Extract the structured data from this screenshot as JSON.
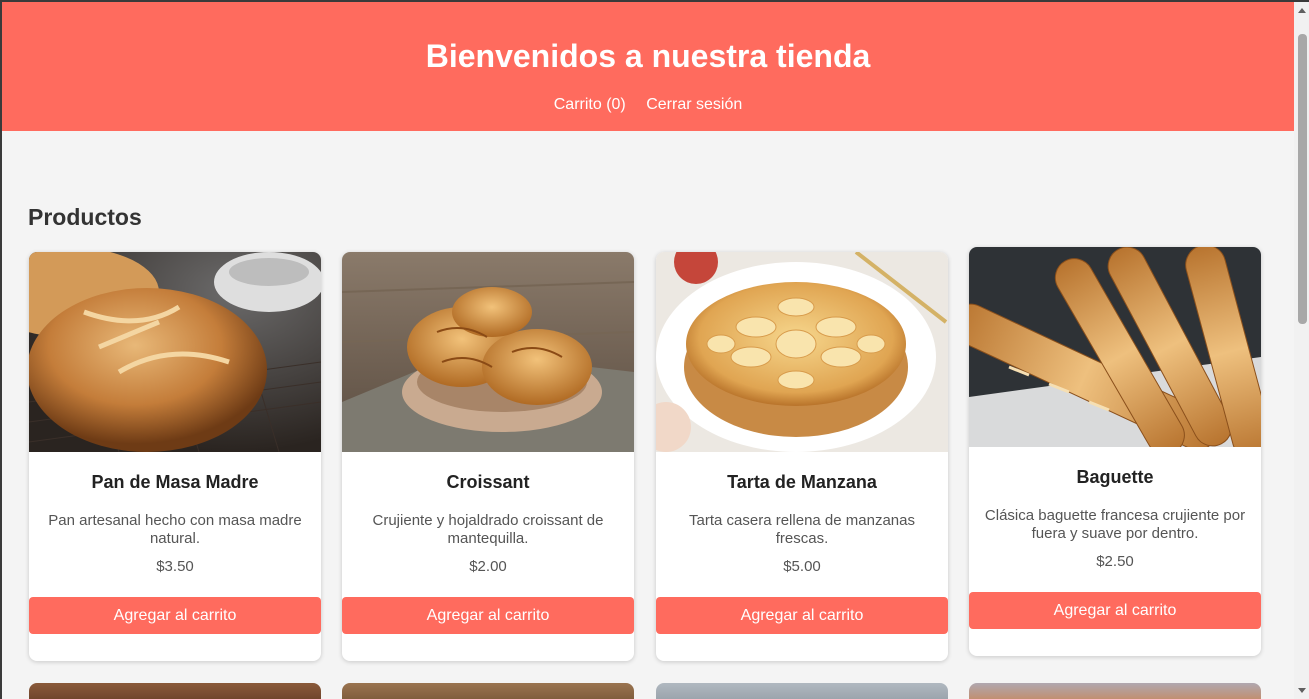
{
  "header": {
    "title": "Bienvenidos a nuestra tienda",
    "cart_link": "Carrito (0)",
    "logout_link": "Cerrar sesión"
  },
  "products_section": {
    "title": "Productos"
  },
  "products": [
    {
      "name": "Pan de Masa Madre",
      "description": "Pan artesanal hecho con masa madre natural.",
      "price": "$3.50",
      "button": "Agregar al carrito",
      "image_icon": "sourdough-bread-image"
    },
    {
      "name": "Croissant",
      "description": "Crujiente y hojaldrado croissant de mantequilla.",
      "price": "$2.00",
      "button": "Agregar al carrito",
      "image_icon": "croissant-image"
    },
    {
      "name": "Tarta de Manzana",
      "description": "Tarta casera rellena de manzanas frescas.",
      "price": "$5.00",
      "button": "Agregar al carrito",
      "image_icon": "apple-tart-image"
    },
    {
      "name": "Baguette",
      "description": "Clásica baguette francesa crujiente por fuera y suave por dentro.",
      "price": "$2.50",
      "button": "Agregar al carrito",
      "image_icon": "baguette-image"
    }
  ],
  "colors": {
    "accent": "#ff6b5e",
    "background": "#f4f4f4"
  }
}
